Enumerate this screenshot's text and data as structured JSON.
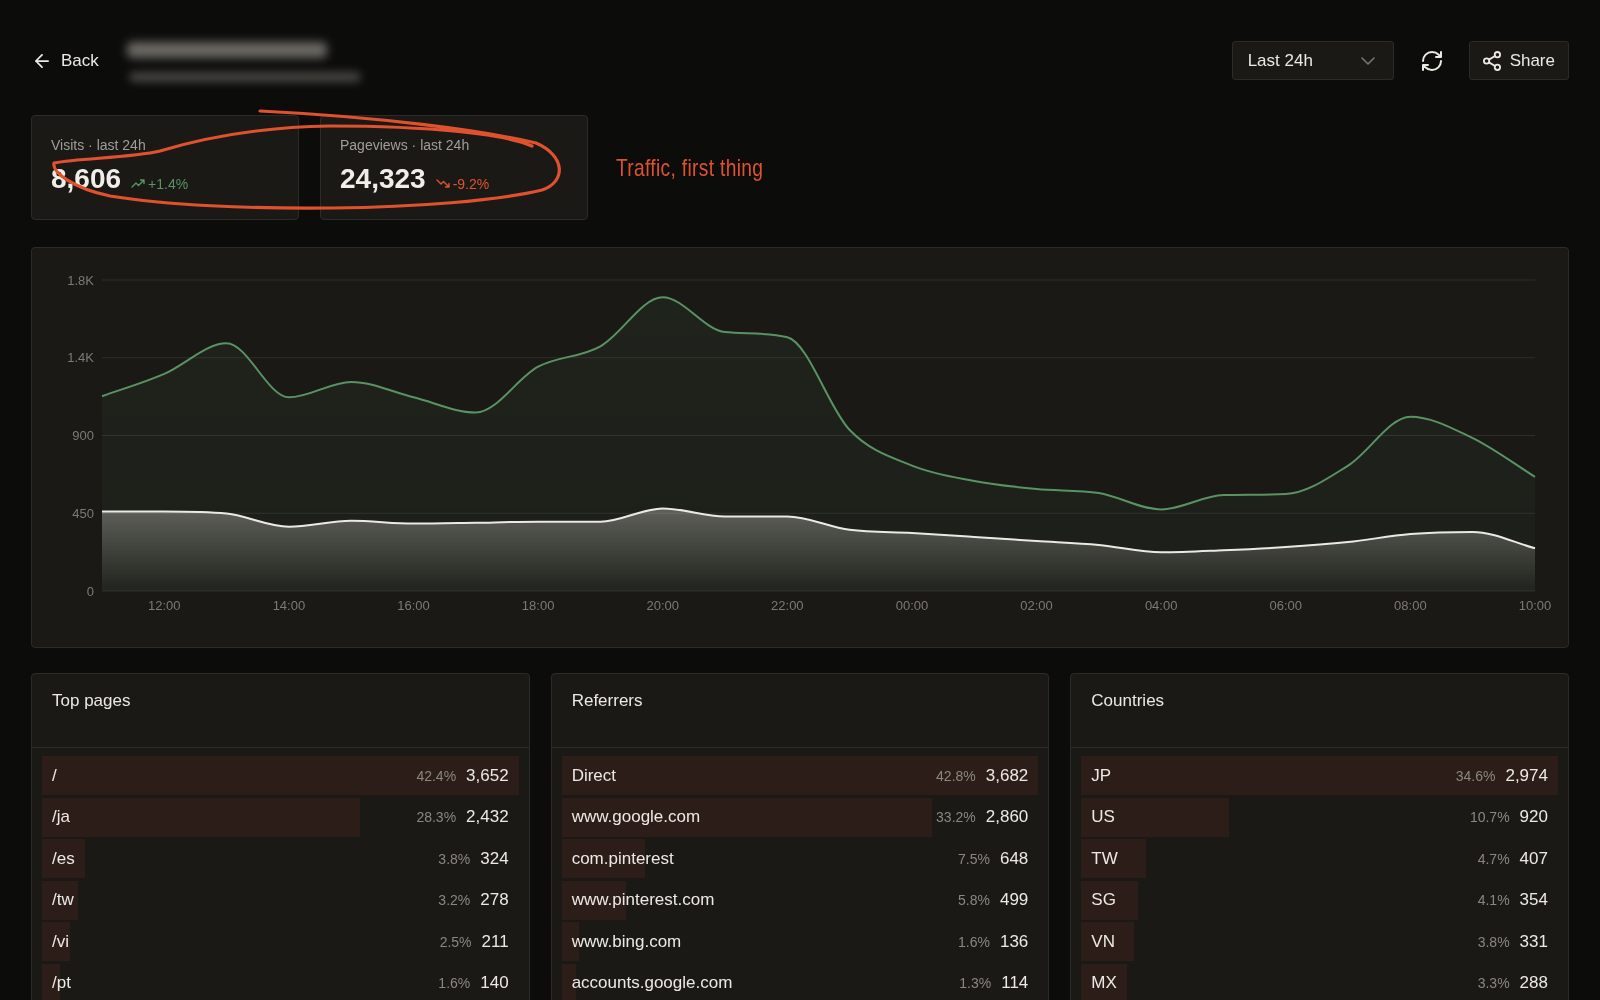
{
  "header": {
    "back": "Back",
    "range_select": {
      "value": "Last 24h"
    },
    "share": "Share"
  },
  "stats": [
    {
      "label": "Visits · last 24h",
      "value": "8,606",
      "delta": "+1.4%",
      "kind": "up"
    },
    {
      "label": "Pageviews · last 24h",
      "value": "24,323",
      "delta": "-9.2%",
      "kind": "down"
    }
  ],
  "annotation": {
    "text": "Traffic, first thing"
  },
  "traffic_chart": {
    "chart_data": {
      "type": "area",
      "categories": [
        null,
        "12:00",
        null,
        "14:00",
        null,
        "16:00",
        null,
        "18:00",
        null,
        "20:00",
        null,
        "22:00",
        null,
        "00:00",
        null,
        "02:00",
        null,
        "04:00",
        null,
        "06:00",
        null,
        "08:00",
        null,
        "10:00"
      ],
      "series": [
        {
          "color": "#5a9363",
          "values": [
            1127,
            1257,
            1434,
            1121,
            1210,
            1121,
            1033,
            1298,
            1416,
            1700,
            1499,
            1469,
            932,
            726,
            637,
            590,
            567,
            472,
            555,
            561,
            726,
            1009,
            885,
            661
          ]
        },
        {
          "color": "#ece9e3",
          "values": [
            460,
            460,
            448,
            372,
            407,
            390,
            395,
            401,
            401,
            478,
            431,
            431,
            354,
            336,
            313,
            289,
            266,
            224,
            236,
            254,
            283,
            330,
            342,
            248
          ]
        }
      ],
      "ylim": [
        0,
        1800
      ],
      "yticks": [
        0,
        450,
        900,
        {
          "value": 1350,
          "label": "1.4K"
        },
        {
          "value": 1800,
          "label": "1.8K"
        }
      ],
      "grid": true
    }
  },
  "panels": [
    {
      "title": "Top pages",
      "rows": [
        {
          "label": "/",
          "share": "42.4%",
          "count": "3,652",
          "level": 1
        },
        {
          "label": "/ja",
          "share": "28.3%",
          "count": "2,432",
          "level": 0.667
        },
        {
          "label": "/es",
          "share": "3.8%",
          "count": "324",
          "level": 0.09
        },
        {
          "label": "/tw",
          "share": "3.2%",
          "count": "278",
          "level": 0.075
        },
        {
          "label": "/vi",
          "share": "2.5%",
          "count": "211",
          "level": 0.059
        },
        {
          "label": "/pt",
          "share": "1.6%",
          "count": "140",
          "level": 0.038
        }
      ]
    },
    {
      "title": "Referrers",
      "rows": [
        {
          "label": "Direct",
          "share": "42.8%",
          "count": "3,682",
          "level": 1
        },
        {
          "label": "www.google.com",
          "share": "33.2%",
          "count": "2,860",
          "level": 0.776
        },
        {
          "label": "com.pinterest",
          "share": "7.5%",
          "count": "648",
          "level": 0.175
        },
        {
          "label": "www.pinterest.com",
          "share": "5.8%",
          "count": "499",
          "level": 0.136
        },
        {
          "label": "www.bing.com",
          "share": "1.6%",
          "count": "136",
          "level": 0.037
        },
        {
          "label": "accounts.google.com",
          "share": "1.3%",
          "count": "114",
          "level": 0.03
        }
      ]
    },
    {
      "title": "Countries",
      "rows": [
        {
          "label": "JP",
          "share": "34.6%",
          "count": "2,974",
          "level": 1
        },
        {
          "label": "US",
          "share": "10.7%",
          "count": "920",
          "level": 0.309
        },
        {
          "label": "TW",
          "share": "4.7%",
          "count": "407",
          "level": 0.136
        },
        {
          "label": "SG",
          "share": "4.1%",
          "count": "354",
          "level": 0.118
        },
        {
          "label": "VN",
          "share": "3.8%",
          "count": "331",
          "level": 0.11
        },
        {
          "label": "MX",
          "share": "3.3%",
          "count": "288",
          "level": 0.095
        }
      ]
    }
  ]
}
